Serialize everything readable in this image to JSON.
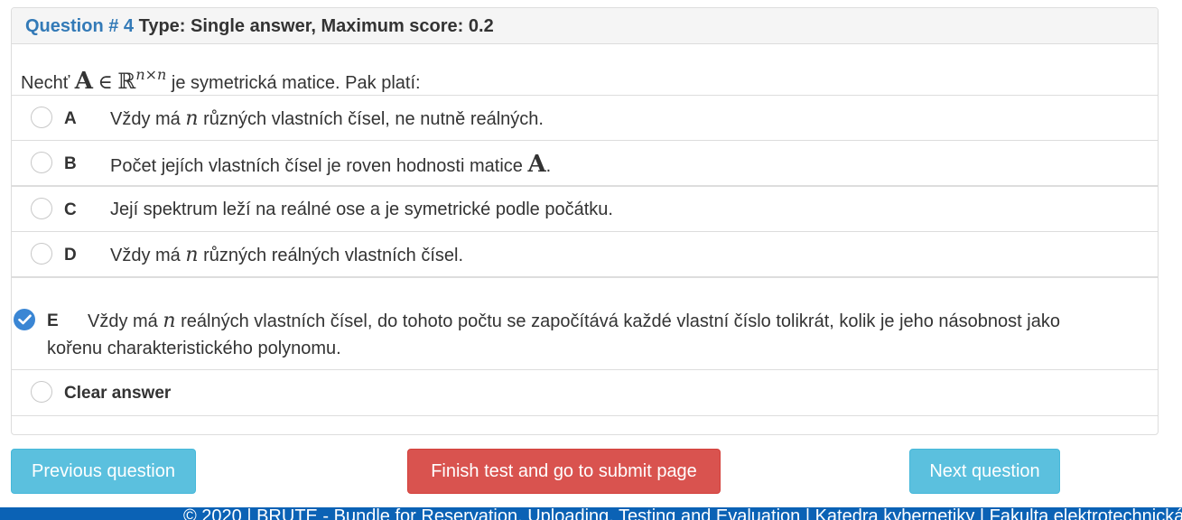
{
  "question": {
    "number_label": "Question # 4",
    "type_label": "Type: Single answer, Maximum score: 0.2",
    "text_prefix": "Nechť",
    "math_A": "A",
    "math_in": "∈",
    "math_R": "ℝ",
    "math_exp": "n×n",
    "text_suffix": "je symetrická matice. Pak platí:"
  },
  "options": [
    {
      "letter": "A",
      "text_before": "Vždy má",
      "math": "n",
      "text_after": "různých vlastních čísel, ne nutně reálných.",
      "checked": false
    },
    {
      "letter": "B",
      "text_before": "Počet jejích vlastních čísel je roven hodnosti matice",
      "math": "A",
      "text_after": ".",
      "checked": false
    },
    {
      "letter": "C",
      "text": "Její spektrum leží na reálné ose a je symetrické podle počátku.",
      "checked": false
    },
    {
      "letter": "D",
      "text_before": "Vždy má",
      "math": "n",
      "text_after": "různých reálných vlastních čísel.",
      "checked": false
    },
    {
      "letter": "E",
      "text_before": "Vždy má",
      "math": "n",
      "text_after": "reálných vlastních čísel, do tohoto počtu se započítává každé vlastní číslo tolikrát, kolik je jeho násobnost jako",
      "text_line2": "kořenu charakteristického polynomu.",
      "checked": true
    }
  ],
  "clear_answer": "Clear answer",
  "buttons": {
    "previous": "Previous question",
    "finish": "Finish test and go to submit page",
    "next": "Next question"
  },
  "footer": {
    "text": "© 2020 |   BRUTE - Bundle for Reservation, Uploading, Testing and Evaluation |   Katedra kybernetiky |   Fakulta elektrotechnická"
  },
  "colors": {
    "accent": "#337ab7",
    "info": "#5bc0de",
    "danger": "#d9534f",
    "checked": "#3a86d4",
    "footer": "#0b62b5"
  }
}
